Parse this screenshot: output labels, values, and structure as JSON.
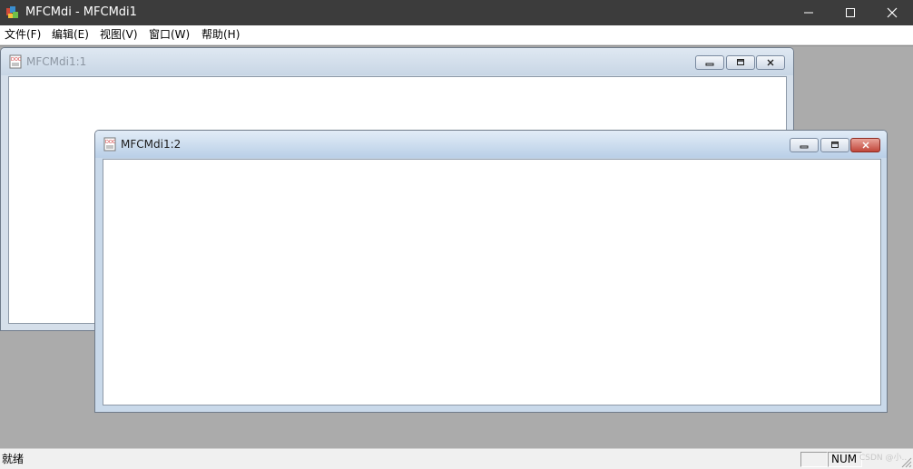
{
  "app": {
    "title": "MFCMdi - MFCMdi1",
    "icon": "mfc-app-icon"
  },
  "window_controls": {
    "minimize": "minimize-icon",
    "maximize": "maximize-icon",
    "close": "close-icon"
  },
  "menu": {
    "items": [
      {
        "label": "文件(F)"
      },
      {
        "label": "编辑(E)"
      },
      {
        "label": "视图(V)"
      },
      {
        "label": "窗口(W)"
      },
      {
        "label": "帮助(H)"
      }
    ]
  },
  "mdi": {
    "children": [
      {
        "title": "MFCMdi1:1",
        "active": false,
        "icon": "document-icon"
      },
      {
        "title": "MFCMdi1:2",
        "active": true,
        "icon": "document-icon"
      }
    ]
  },
  "status": {
    "text": "就绪",
    "num_indicator": "NUM",
    "watermark": "CSDN @小.."
  },
  "colors": {
    "titlebar": "#3c3c3c",
    "client_bg": "#ababab",
    "child_close_active": "#c1463a"
  }
}
